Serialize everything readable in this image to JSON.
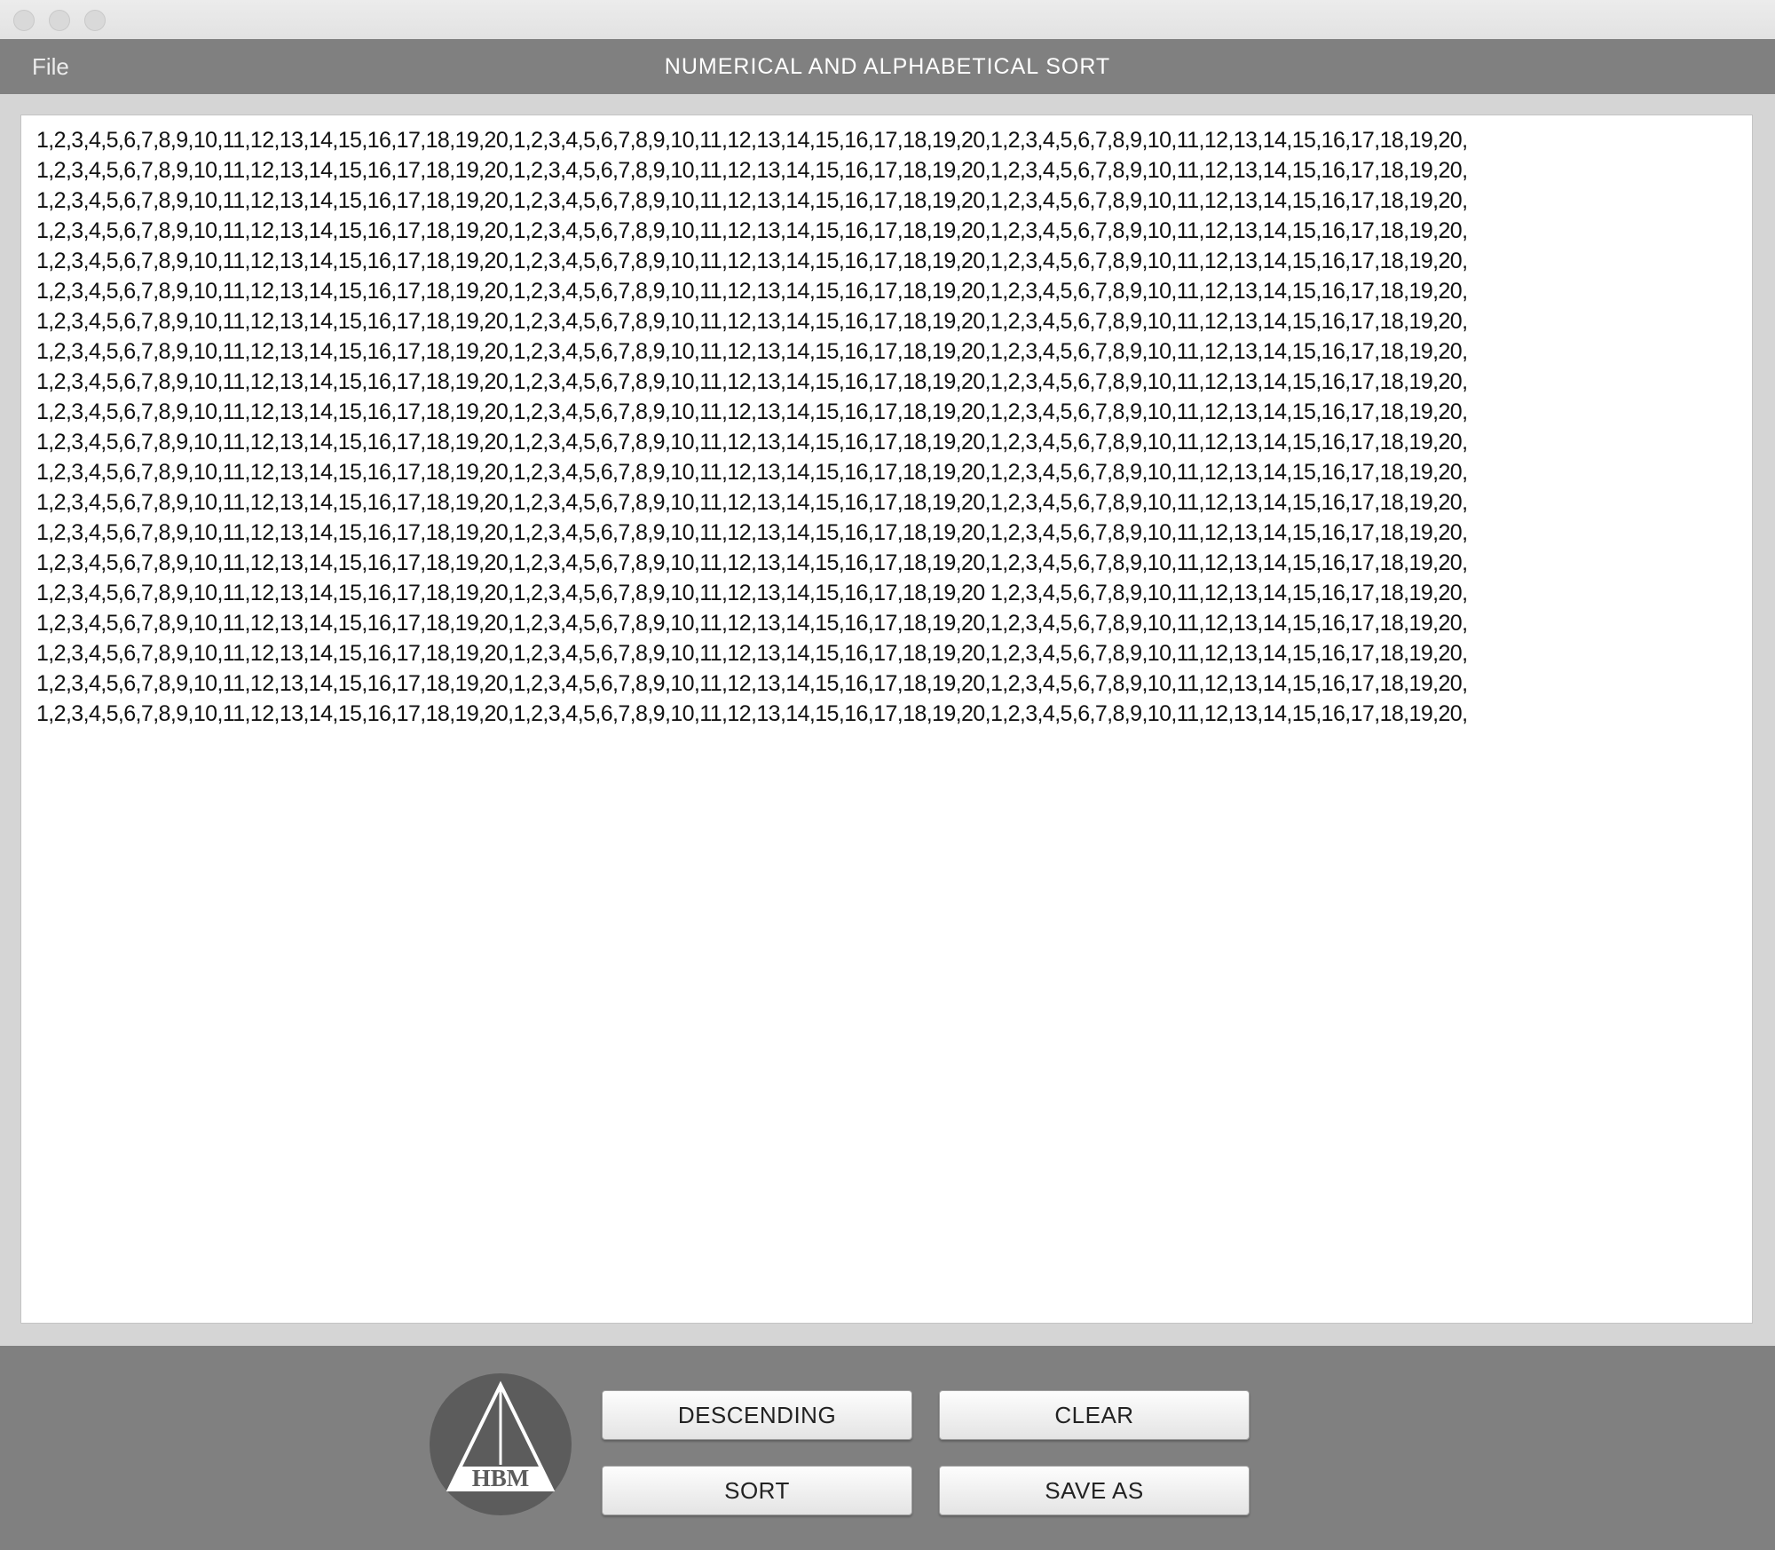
{
  "window": {
    "title": "NUMERICAL AND ALPHABETICAL SORT"
  },
  "menu": {
    "file_label": "File"
  },
  "textarea": {
    "lines": [
      "1,2,3,4,5,6,7,8,9,10,11,12,13,14,15,16,17,18,19,20,1,2,3,4,5,6,7,8,9,10,11,12,13,14,15,16,17,18,19,20,1,2,3,4,5,6,7,8,9,10,11,12,13,14,15,16,17,18,19,20,",
      "1,2,3,4,5,6,7,8,9,10,11,12,13,14,15,16,17,18,19,20,1,2,3,4,5,6,7,8,9,10,11,12,13,14,15,16,17,18,19,20,1,2,3,4,5,6,7,8,9,10,11,12,13,14,15,16,17,18,19,20,",
      "1,2,3,4,5,6,7,8,9,10,11,12,13,14,15,16,17,18,19,20,1,2,3,4,5,6,7,8,9,10,11,12,13,14,15,16,17,18,19,20,1,2,3,4,5,6,7,8,9,10,11,12,13,14,15,16,17,18,19,20,",
      "1,2,3,4,5,6,7,8,9,10,11,12,13,14,15,16,17,18,19,20,1,2,3,4,5,6,7,8,9,10,11,12,13,14,15,16,17,18,19,20,1,2,3,4,5,6,7,8,9,10,11,12,13,14,15,16,17,18,19,20,",
      "1,2,3,4,5,6,7,8,9,10,11,12,13,14,15,16,17,18,19,20,1,2,3,4,5,6,7,8,9,10,11,12,13,14,15,16,17,18,19,20,1,2,3,4,5,6,7,8,9,10,11,12,13,14,15,16,17,18,19,20,",
      "1,2,3,4,5,6,7,8,9,10,11,12,13,14,15,16,17,18,19,20,1,2,3,4,5,6,7,8,9,10,11,12,13,14,15,16,17,18,19,20,1,2,3,4,5,6,7,8,9,10,11,12,13,14,15,16,17,18,19,20,",
      "1,2,3,4,5,6,7,8,9,10,11,12,13,14,15,16,17,18,19,20,1,2,3,4,5,6,7,8,9,10,11,12,13,14,15,16,17,18,19,20,1,2,3,4,5,6,7,8,9,10,11,12,13,14,15,16,17,18,19,20,",
      "1,2,3,4,5,6,7,8,9,10,11,12,13,14,15,16,17,18,19,20,1,2,3,4,5,6,7,8,9,10,11,12,13,14,15,16,17,18,19,20,1,2,3,4,5,6,7,8,9,10,11,12,13,14,15,16,17,18,19,20,",
      "1,2,3,4,5,6,7,8,9,10,11,12,13,14,15,16,17,18,19,20,1,2,3,4,5,6,7,8,9,10,11,12,13,14,15,16,17,18,19,20,1,2,3,4,5,6,7,8,9,10,11,12,13,14,15,16,17,18,19,20,",
      "1,2,3,4,5,6,7,8,9,10,11,12,13,14,15,16,17,18,19,20,1,2,3,4,5,6,7,8,9,10,11,12,13,14,15,16,17,18,19,20,1,2,3,4,5,6,7,8,9,10,11,12,13,14,15,16,17,18,19,20,",
      "1,2,3,4,5,6,7,8,9,10,11,12,13,14,15,16,17,18,19,20,1,2,3,4,5,6,7,8,9,10,11,12,13,14,15,16,17,18,19,20,1,2,3,4,5,6,7,8,9,10,11,12,13,14,15,16,17,18,19,20,",
      "1,2,3,4,5,6,7,8,9,10,11,12,13,14,15,16,17,18,19,20,1,2,3,4,5,6,7,8,9,10,11,12,13,14,15,16,17,18,19,20,1,2,3,4,5,6,7,8,9,10,11,12,13,14,15,16,17,18,19,20,",
      "1,2,3,4,5,6,7,8,9,10,11,12,13,14,15,16,17,18,19,20,1,2,3,4,5,6,7,8,9,10,11,12,13,14,15,16,17,18,19,20,1,2,3,4,5,6,7,8,9,10,11,12,13,14,15,16,17,18,19,20,",
      "1,2,3,4,5,6,7,8,9,10,11,12,13,14,15,16,17,18,19,20,1,2,3,4,5,6,7,8,9,10,11,12,13,14,15,16,17,18,19,20,1,2,3,4,5,6,7,8,9,10,11,12,13,14,15,16,17,18,19,20,",
      "1,2,3,4,5,6,7,8,9,10,11,12,13,14,15,16,17,18,19,20,1,2,3,4,5,6,7,8,9,10,11,12,13,14,15,16,17,18,19,20,1,2,3,4,5,6,7,8,9,10,11,12,13,14,15,16,17,18,19,20,",
      "1,2,3,4,5,6,7,8,9,10,11,12,13,14,15,16,17,18,19,20,1,2,3,4,5,6,7,8,9,10,11,12,13,14,15,16,17,18,19,20 1,2,3,4,5,6,7,8,9,10,11,12,13,14,15,16,17,18,19,20,",
      "1,2,3,4,5,6,7,8,9,10,11,12,13,14,15,16,17,18,19,20,1,2,3,4,5,6,7,8,9,10,11,12,13,14,15,16,17,18,19,20,1,2,3,4,5,6,7,8,9,10,11,12,13,14,15,16,17,18,19,20,",
      "1,2,3,4,5,6,7,8,9,10,11,12,13,14,15,16,17,18,19,20,1,2,3,4,5,6,7,8,9,10,11,12,13,14,15,16,17,18,19,20,1,2,3,4,5,6,7,8,9,10,11,12,13,14,15,16,17,18,19,20,",
      "1,2,3,4,5,6,7,8,9,10,11,12,13,14,15,16,17,18,19,20,1,2,3,4,5,6,7,8,9,10,11,12,13,14,15,16,17,18,19,20,1,2,3,4,5,6,7,8,9,10,11,12,13,14,15,16,17,18,19,20,",
      "1,2,3,4,5,6,7,8,9,10,11,12,13,14,15,16,17,18,19,20,1,2,3,4,5,6,7,8,9,10,11,12,13,14,15,16,17,18,19,20,1,2,3,4,5,6,7,8,9,10,11,12,13,14,15,16,17,18,19,20,"
    ]
  },
  "logo": {
    "text": "HBM",
    "icon": "hbm-triangle-logo"
  },
  "buttons": {
    "descending": "DESCENDING",
    "clear": "CLEAR",
    "sort": "SORT",
    "save_as": "SAVE AS"
  },
  "colors": {
    "header_bg": "#808080",
    "panel_bg": "#808080",
    "window_bg": "#d5d5d5",
    "textarea_bg": "#ffffff"
  }
}
